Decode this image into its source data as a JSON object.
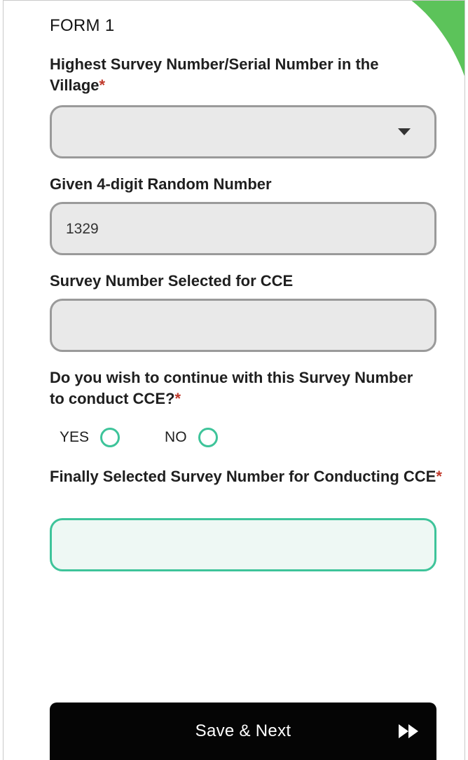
{
  "form": {
    "title": "FORM 1",
    "fields": [
      {
        "label": "Highest Survey Number/Serial Number in the Village",
        "required_mark": "*",
        "type": "dropdown",
        "value": ""
      },
      {
        "label": "Given 4-digit Random Number",
        "type": "text",
        "value": "1329"
      },
      {
        "label": "Survey Number Selected for CCE",
        "type": "text",
        "value": ""
      },
      {
        "label": "Do you wish to continue with this Survey Number to conduct CCE?",
        "required_mark": "*",
        "type": "radio",
        "options": [
          "YES",
          "NO"
        ]
      },
      {
        "label": "Finally Selected Survey Number for Conducting CCE",
        "required_mark": "*",
        "type": "text",
        "value": ""
      }
    ]
  },
  "footer": {
    "save_label": "Save & Next"
  },
  "icons": {
    "dropdown": "chevron-down-icon",
    "next": "fast-forward-icon"
  },
  "colors": {
    "accent": "#3ec49a",
    "corner": "#5cc35a",
    "required": "#c0392b",
    "button": "#050505"
  }
}
